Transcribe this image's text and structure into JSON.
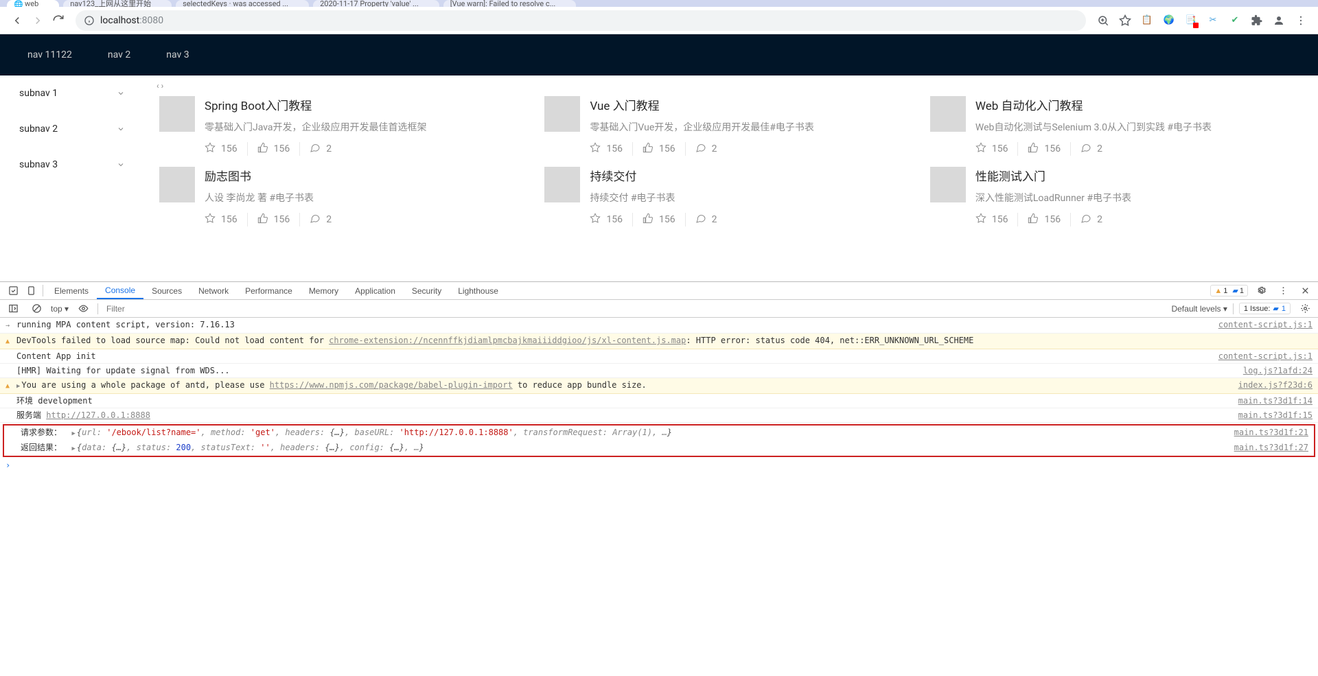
{
  "browser": {
    "tabs": [
      {
        "label": "web"
      },
      {
        "label": "nav123_上网从这里开始"
      },
      {
        "label": "selectedKeys · was accessed ..."
      },
      {
        "label": "2020-11-17 Property 'value' ..."
      },
      {
        "label": "[Vue warn]: Failed to resolve c..."
      }
    ],
    "url_host": "localhost",
    "url_port": ":8080"
  },
  "main_nav": [
    "nav 11122",
    "nav 2",
    "nav 3"
  ],
  "sidebar": [
    "subnav 1",
    "subnav 2",
    "subnav 3"
  ],
  "dots": "‹ ›",
  "cards": [
    {
      "title": "Spring Boot入门教程",
      "desc": "零基础入门Java开发，企业级应用开发最佳首选框架",
      "star": 156,
      "like": 156,
      "chat": 2
    },
    {
      "title": "Vue 入门教程",
      "desc": "零基础入门Vue开发，企业级应用开发最佳#电子书表",
      "star": 156,
      "like": 156,
      "chat": 2
    },
    {
      "title": "Web 自动化入门教程",
      "desc": "Web自动化测试与Selenium 3.0从入门到实践 #电子书表",
      "star": 156,
      "like": 156,
      "chat": 2
    },
    {
      "title": "励志图书",
      "desc": "人设 李尚龙 著 #电子书表",
      "star": 156,
      "like": 156,
      "chat": 2
    },
    {
      "title": "持续交付",
      "desc": "持续交付 #电子书表",
      "star": 156,
      "like": 156,
      "chat": 2
    },
    {
      "title": "性能测试入门",
      "desc": "深入性能测试LoadRunner #电子书表",
      "star": 156,
      "like": 156,
      "chat": 2
    }
  ],
  "devtools": {
    "tabs": [
      "Elements",
      "Console",
      "Sources",
      "Network",
      "Performance",
      "Memory",
      "Application",
      "Security",
      "Lighthouse"
    ],
    "active_tab": "Console",
    "warn_count": "1",
    "msg_count": "1",
    "top": "top ▾",
    "filter_placeholder": "Filter",
    "levels": "Default levels ▾",
    "issues": "1 Issue:",
    "issues_blue": "1",
    "logs": {
      "l0": "running MPA content script, version: 7.16.13",
      "l0_src": "content-script.js:1",
      "l1_pre": "DevTools failed to load source map: Could not load content for ",
      "l1_link": "chrome-extension://ncennffkjdiamlpmcbajkmaiiiddgioo/js/xl-content.js.map",
      "l1_post": ": HTTP error: status code 404, net::ERR_UNKNOWN_URL_SCHEME",
      "l2": "Content App init",
      "l2_src": "content-script.js:1",
      "l3": "[HMR] Waiting for update signal from WDS...",
      "l3_src": "log.js?1afd:24",
      "l4_pre": "You are using a whole package of antd, please use ",
      "l4_link": "https://www.npmjs.com/package/babel-plugin-import",
      "l4_post": " to reduce app bundle size.",
      "l4_src": "index.js?f23d:6",
      "l5": "环境 development",
      "l5_src": "main.ts?3d1f:14",
      "l6_pre": "服务端 ",
      "l6_link": "http://127.0.0.1:8888",
      "l6_src": "main.ts?3d1f:15",
      "l7_label": "请求参数：  ",
      "l7_url": "'/ebook/list?name='",
      "l7_method": "'get'",
      "l7_baseURL": "'http://127.0.0.1:8888'",
      "l7_src": "main.ts?3d1f:21",
      "l8_label": "返回结果：  ",
      "l8_status": "200",
      "l8_src": "main.ts?3d1f:27"
    }
  }
}
